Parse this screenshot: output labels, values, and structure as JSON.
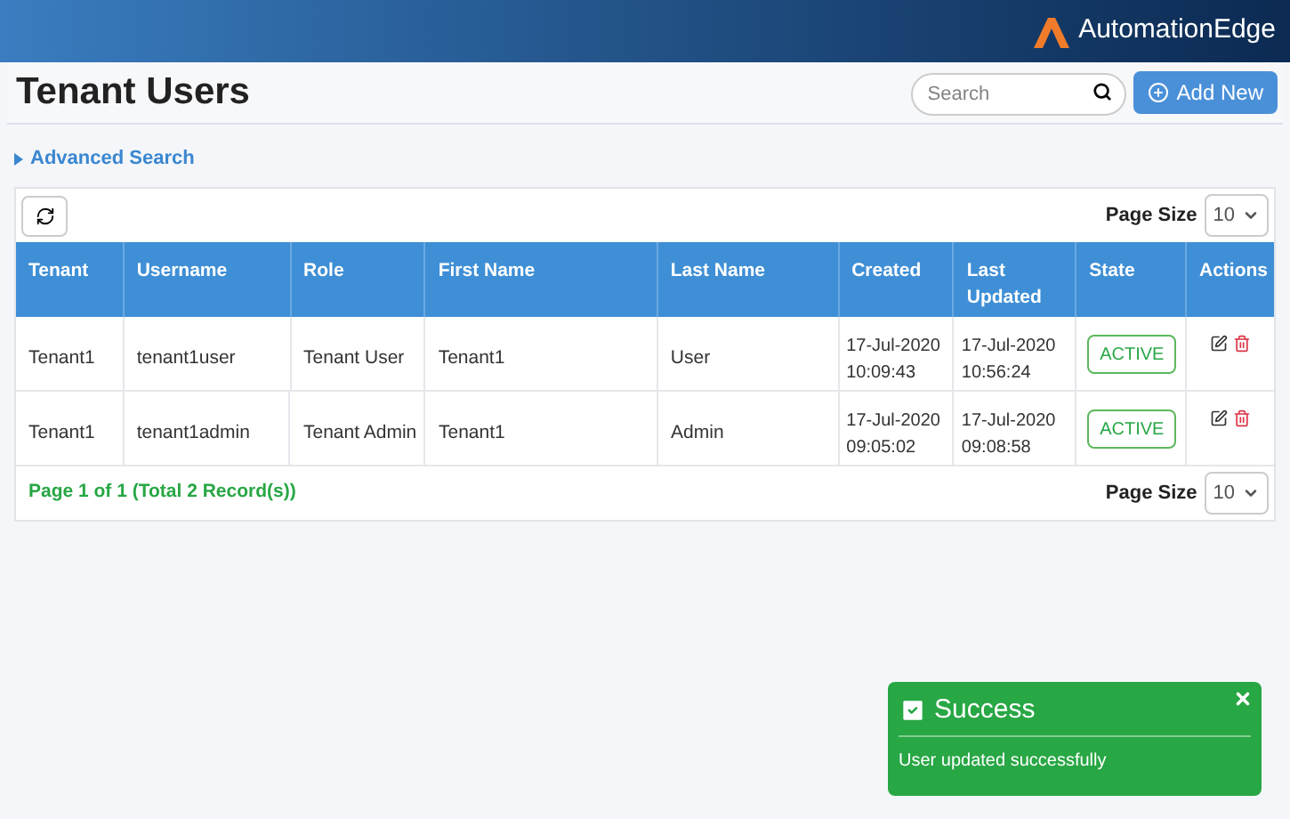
{
  "brand": "AutomationEdge",
  "page_title": "Tenant Users",
  "search": {
    "placeholder": "Search"
  },
  "add_button": "Add New",
  "advanced_search": {
    "label": "Advanced Search",
    "expanded": false
  },
  "top_pager": {
    "label": "Page Size",
    "value": "10"
  },
  "bottom_pager": {
    "label": "Page Size",
    "value": "10"
  },
  "table": {
    "columns": [
      "Tenant",
      "Username",
      "Role",
      "First Name",
      "Last Name",
      "Created",
      "Last Updated",
      "State",
      "Actions"
    ],
    "rows": [
      {
        "tenant": "Tenant1",
        "username": "tenant1user",
        "role": "Tenant User",
        "first_name": "Tenant1",
        "last_name": "User",
        "created": [
          "17-Jul-2020",
          "10:09:43"
        ],
        "last_updated": [
          "17-Jul-2020",
          "10:56:24"
        ],
        "state": "ACTIVE"
      },
      {
        "tenant": "Tenant1",
        "username": "tenant1admin",
        "role": "Tenant Admin",
        "first_name": "Tenant1",
        "last_name": "Admin",
        "created": [
          "17-Jul-2020",
          "09:05:02"
        ],
        "last_updated": [
          "17-Jul-2020",
          "09:08:58"
        ],
        "state": "ACTIVE"
      }
    ]
  },
  "pagination": "Page 1 of 1 (Total 2 Record(s))",
  "toast": {
    "title": "Success",
    "message": "User updated successfully"
  }
}
